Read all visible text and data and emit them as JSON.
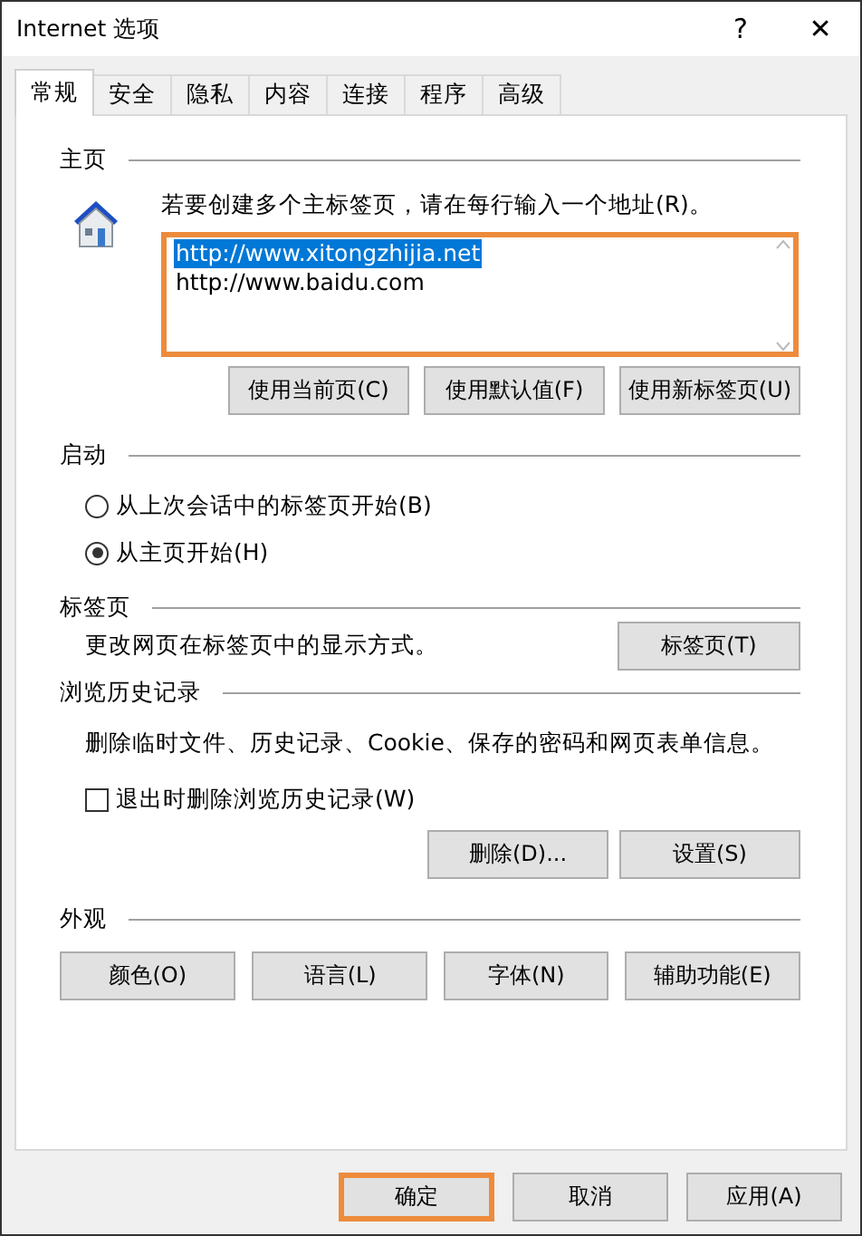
{
  "window": {
    "title": "Internet 选项",
    "help": "?",
    "close": "✕"
  },
  "tabs": [
    {
      "label": "常规",
      "selected": true
    },
    {
      "label": "安全",
      "selected": false
    },
    {
      "label": "隐私",
      "selected": false
    },
    {
      "label": "内容",
      "selected": false
    },
    {
      "label": "连接",
      "selected": false
    },
    {
      "label": "程序",
      "selected": false
    },
    {
      "label": "高级",
      "selected": false
    }
  ],
  "home": {
    "heading": "主页",
    "instruction": "若要创建多个主标签页，请在每行输入一个地址(R)。",
    "addresses": [
      {
        "text": "http://www.xitongzhijia.net",
        "selected": true
      },
      {
        "text": "http://www.baidu.com",
        "selected": false
      }
    ],
    "highlighted": true,
    "buttons": [
      "使用当前页(C)",
      "使用默认值(F)",
      "使用新标签页(U)"
    ]
  },
  "startup": {
    "heading": "启动",
    "options": [
      {
        "label": "从上次会话中的标签页开始(B)",
        "selected": false
      },
      {
        "label": "从主页开始(H)",
        "selected": true
      }
    ]
  },
  "tabs_section": {
    "heading": "标签页",
    "description": "更改网页在标签页中的显示方式。",
    "button": "标签页(T)"
  },
  "history": {
    "heading": "浏览历史记录",
    "description": "删除临时文件、历史记录、Cookie、保存的密码和网页表单信息。",
    "checkbox": {
      "label": "退出时删除浏览历史记录(W)",
      "checked": false
    },
    "buttons": [
      "删除(D)...",
      "设置(S)"
    ]
  },
  "appearance": {
    "heading": "外观",
    "buttons": [
      "颜色(O)",
      "语言(L)",
      "字体(N)",
      "辅助功能(E)"
    ]
  },
  "footer": [
    {
      "label": "确定",
      "highlighted": true
    },
    {
      "label": "取消",
      "highlighted": false
    },
    {
      "label": "应用(A)",
      "highlighted": false
    }
  ]
}
